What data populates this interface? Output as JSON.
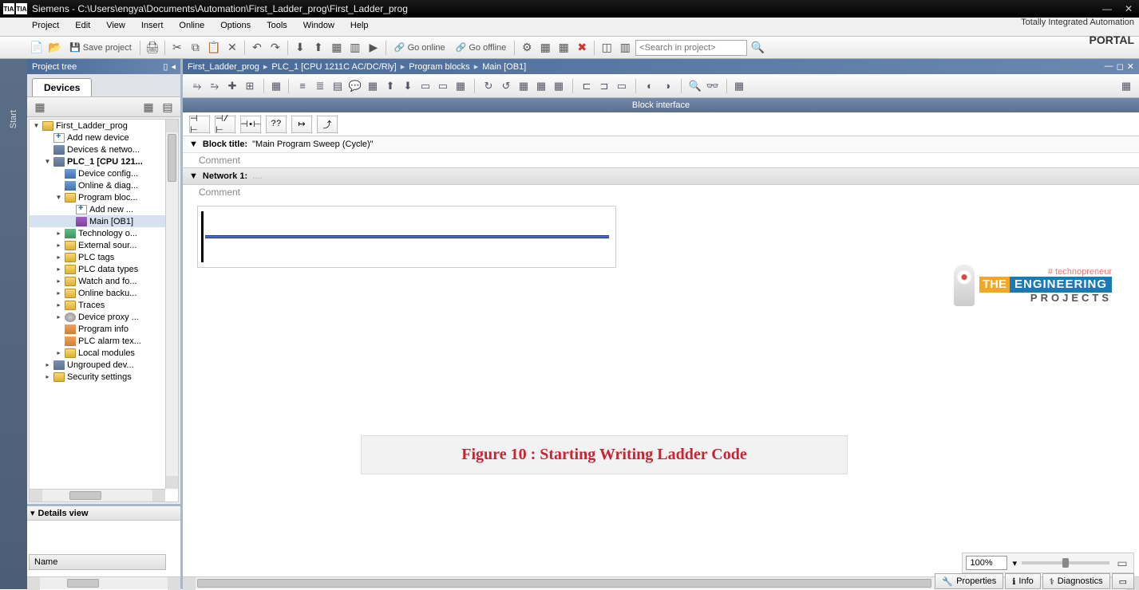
{
  "title": "Siemens  -  C:\\Users\\engya\\Documents\\Automation\\First_Ladder_prog\\First_Ladder_prog",
  "menus": [
    "Project",
    "Edit",
    "View",
    "Insert",
    "Online",
    "Options",
    "Tools",
    "Window",
    "Help"
  ],
  "branding_line1": "Totally Integrated Automation",
  "branding_line2": "PORTAL",
  "toolbar": {
    "save_label": "Save project",
    "go_online": "Go online",
    "go_offline": "Go offline",
    "search_placeholder": "<Search in project>"
  },
  "sidebar": {
    "title": "Project tree",
    "tab": "Devices",
    "start_tab": "Start",
    "details_title": "Details view",
    "name_header": "Name",
    "tree": [
      {
        "lvl": 0,
        "exp": "▼",
        "ico": "ico-folder",
        "label": "First_Ladder_prog"
      },
      {
        "lvl": 1,
        "exp": "",
        "ico": "ico-add",
        "label": "Add new device"
      },
      {
        "lvl": 1,
        "exp": "",
        "ico": "ico-device",
        "label": "Devices & netwo..."
      },
      {
        "lvl": 1,
        "exp": "▼",
        "ico": "ico-device",
        "label": "PLC_1 [CPU 121...",
        "bold": true
      },
      {
        "lvl": 2,
        "exp": "",
        "ico": "ico-blue",
        "label": "Device config..."
      },
      {
        "lvl": 2,
        "exp": "",
        "ico": "ico-blue",
        "label": "Online & diag..."
      },
      {
        "lvl": 2,
        "exp": "▼",
        "ico": "ico-folder",
        "label": "Program bloc..."
      },
      {
        "lvl": 3,
        "exp": "",
        "ico": "ico-add",
        "label": "Add new ..."
      },
      {
        "lvl": 3,
        "exp": "",
        "ico": "ico-block",
        "label": "Main [OB1]",
        "sel": true
      },
      {
        "lvl": 2,
        "exp": "▸",
        "ico": "ico-tech",
        "label": "Technology o..."
      },
      {
        "lvl": 2,
        "exp": "▸",
        "ico": "ico-folder",
        "label": "External sour..."
      },
      {
        "lvl": 2,
        "exp": "▸",
        "ico": "ico-folder",
        "label": "PLC tags"
      },
      {
        "lvl": 2,
        "exp": "▸",
        "ico": "ico-folder",
        "label": "PLC data types"
      },
      {
        "lvl": 2,
        "exp": "▸",
        "ico": "ico-folder",
        "label": "Watch and fo..."
      },
      {
        "lvl": 2,
        "exp": "▸",
        "ico": "ico-folder",
        "label": "Online backu..."
      },
      {
        "lvl": 2,
        "exp": "▸",
        "ico": "ico-folder",
        "label": "Traces"
      },
      {
        "lvl": 2,
        "exp": "▸",
        "ico": "ico-gear",
        "label": "Device proxy ..."
      },
      {
        "lvl": 2,
        "exp": "",
        "ico": "ico-orange",
        "label": "Program info"
      },
      {
        "lvl": 2,
        "exp": "",
        "ico": "ico-orange",
        "label": "PLC alarm tex..."
      },
      {
        "lvl": 2,
        "exp": "▸",
        "ico": "ico-folder",
        "label": "Local modules"
      },
      {
        "lvl": 1,
        "exp": "▸",
        "ico": "ico-device",
        "label": "Ungrouped dev..."
      },
      {
        "lvl": 1,
        "exp": "▸",
        "ico": "ico-folder",
        "label": "Security settings"
      }
    ]
  },
  "breadcrumb": [
    "First_Ladder_prog",
    "PLC_1 [CPU 1211C AC/DC/Rly]",
    "Program blocks",
    "Main [OB1]"
  ],
  "block_interface": "Block interface",
  "ladder_buttons": [
    "⊣ ⊢",
    "⊣/⊢",
    "⊣•⊢",
    "??",
    "↦",
    "⤴"
  ],
  "block_title_label": "Block title:",
  "block_title_value": "\"Main Program Sweep (Cycle)\"",
  "comment_label": "Comment",
  "network_label": "Network 1:",
  "network_suffix": "....",
  "zoom": "100%",
  "prop_tabs": [
    "Properties",
    "Info",
    "Diagnostics"
  ],
  "figure_caption": "Figure 10 : Starting Writing Ladder Code",
  "tep": {
    "hash": "# technopreneur",
    "the": "THE",
    "eng": "ENGINEERING",
    "proj": "PROJECTS"
  }
}
